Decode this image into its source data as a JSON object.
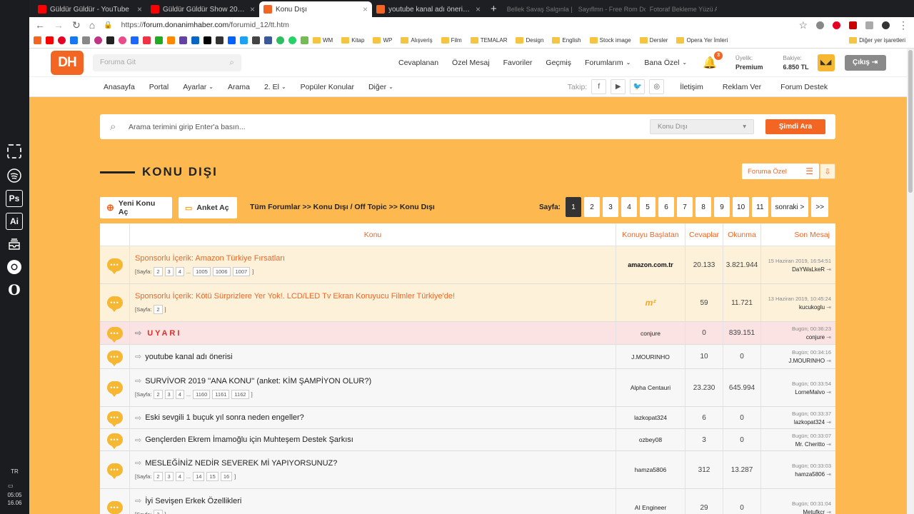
{
  "os": {
    "lang": "TR",
    "time": "05:05",
    "date": "16.06",
    "apps": [
      "screenshot-tool-icon",
      "spotify-icon",
      "photoshop-icon",
      "illustrator-icon",
      "inbox-icon",
      "chrome-icon",
      "opera-icon"
    ],
    "ps": "Ps",
    "ai": "Ai",
    "opera": "O"
  },
  "browser": {
    "tabs": [
      {
        "title": "Güldür Güldür - YouTube",
        "color": "#ff0000"
      },
      {
        "title": "Güldür Güldür Show 204.Bölüm (Tek",
        "color": "#ff0000"
      },
      {
        "title": "Konu Dışı",
        "color": "#f26522",
        "active": true
      },
      {
        "title": "youtube kanal adı önerisi » Sayfa 1",
        "color": "#f26522"
      }
    ],
    "ghost_tabs": [
      "Bellek Savaş Salgınla | MVP",
      "Sayıflmn - Free Rom Dow",
      "Fotoraf Bekleme Yüzü Ayı Gele"
    ],
    "url_prefix": "https://",
    "url_host": "forum.donanimhaber.com",
    "url_path": "/forumid_12/tt.htm",
    "bookmarks": [
      "WM",
      "Kitap",
      "WP",
      "Alışveriş",
      "Film",
      "TEMALAR",
      "Design",
      "English",
      "Stock image",
      "Dersler",
      "Opera Yer İmleri"
    ],
    "other_bookmarks": "Diğer yer işaretleri"
  },
  "site": {
    "logo": "DH",
    "go_placeholder": "Foruma Git",
    "nav": [
      "Cevaplanan",
      "Özel Mesaj",
      "Favoriler",
      "Geçmiş",
      "Forumlarım",
      "Bana Özel"
    ],
    "notif_count": "3",
    "membership_label": "Üyelik:",
    "membership": "Premium",
    "balance_label": "Bakiye:",
    "balance": "6.850 TL",
    "logout": "Çıkış",
    "subnav": [
      "Anasayfa",
      "Portal",
      "Ayarlar",
      "Arama",
      "2. El",
      "Popüler Konular",
      "Diğer"
    ],
    "follow": "Takip:",
    "right_links": [
      "İletişim",
      "Reklam Ver",
      "Forum Destek"
    ]
  },
  "search": {
    "placeholder": "Arama terimini girip Enter'a basın...",
    "scope": "Konu Dışı",
    "button": "Şimdi Ara"
  },
  "forum": {
    "title": "KONU DIŞI",
    "sort": "Foruma Özel",
    "new_topic": "Yeni Konu Aç",
    "new_poll": "Anket Aç",
    "breadcrumb": "Tüm Forumlar >> Konu Dışı / Off Topic >> Konu Dışı",
    "page_label": "Sayfa:",
    "pages": [
      "1",
      "2",
      "3",
      "4",
      "5",
      "6",
      "7",
      "8",
      "9",
      "10",
      "11",
      "sonraki >",
      ">>"
    ],
    "columns": [
      "Konu",
      "Konuyu Başlatan",
      "Cevaplar",
      "Okunma",
      "Son Mesaj"
    ],
    "rows": [
      {
        "title": "Sponsorlu İçerik: Amazon Türkiye Fırsatları",
        "style": "sp",
        "starter": "amazon.com.tr",
        "starter_logo": "amazon",
        "replies": "20.133",
        "views": "3.821.944",
        "last_date": "15 Haziran 2019, 16:54:51",
        "last_user": "DaYWaLkeR",
        "pages": [
          "2",
          "3",
          "4",
          "...",
          "1005",
          "1006",
          "1007"
        ]
      },
      {
        "title": "Sponsorlu İçerik: Kötü Sürprizlere Yer Yok!. LCD/LED Tv Ekran Koruyucu Filmler Türkiye'de!",
        "style": "sp",
        "starter": "m²",
        "starter_logo": "m",
        "replies": "59",
        "views": "11.721",
        "last_date": "13 Haziran 2019, 10:45:24",
        "last_user": "kucukoglu",
        "pages": [
          "2"
        ]
      },
      {
        "title": "UYARI",
        "style": "warn",
        "starter": "conjure",
        "replies": "0",
        "views": "839.151",
        "last_date": "Bugün; 00:36:23",
        "last_user": "conjure",
        "pages": []
      },
      {
        "title": "youtube kanal adı önerisi",
        "style": "",
        "starter": "J.MOURINHO",
        "replies": "10",
        "views": "0",
        "last_date": "Bugün; 00:34:16",
        "last_user": "J.MOURINHO",
        "pages": []
      },
      {
        "title": "SURVİVOR 2019 ''ANA KONU'' (anket: KİM ŞAMPİYON OLUR?)",
        "style": "",
        "starter": "Alpha Centauri",
        "replies": "23.230",
        "views": "645.994",
        "last_date": "Bugün; 00:33:54",
        "last_user": "LorneMalvo",
        "pages": [
          "2",
          "3",
          "4",
          "...",
          "1160",
          "1161",
          "1162"
        ]
      },
      {
        "title": "Eski sevgili 1 buçuk yıl sonra neden engeller?",
        "style": "",
        "starter": "lazkopat324",
        "replies": "6",
        "views": "0",
        "last_date": "Bugün; 00:33:37",
        "last_user": "lazkopat324",
        "pages": []
      },
      {
        "title": "Gençlerden Ekrem İmamoğlu için Muhteşem Destek Şarkısı",
        "style": "",
        "starter": "ozbey08",
        "replies": "3",
        "views": "0",
        "last_date": "Bugün; 00:33:07",
        "last_user": "Mr. Cheritto",
        "pages": []
      },
      {
        "title": "MESLEĞİNİZ NEDİR SEVEREK Mİ YAPIYORSUNUZ?",
        "style": "",
        "starter": "hamza5806",
        "replies": "312",
        "views": "13.287",
        "last_date": "Bugün; 00:33:03",
        "last_user": "hamza5806",
        "pages": [
          "2",
          "3",
          "4",
          "...",
          "14",
          "15",
          "16"
        ]
      },
      {
        "title": "İyi Sevişen Erkek Özellikleri",
        "style": "",
        "starter": "AI Engineer",
        "replies": "29",
        "views": "0",
        "last_date": "Bugün; 00:31:04",
        "last_user": "Metufkcr",
        "pages": [
          "2"
        ]
      }
    ]
  },
  "colors": {
    "accent": "#f26522",
    "page_bg": "#fdb94f",
    "sponsor_row": "#fdf1da",
    "warn_row": "#fbe3e3"
  }
}
